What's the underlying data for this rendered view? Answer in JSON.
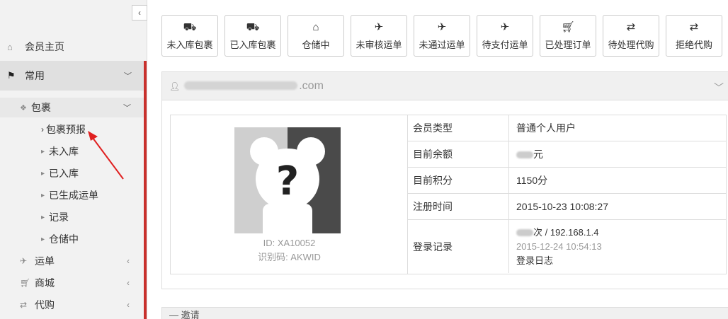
{
  "sidebar": {
    "collapse_glyph": "‹",
    "home": {
      "label": "会员主页",
      "icon": "home-icon"
    },
    "common": {
      "label": "常用",
      "icon": "flag-icon"
    },
    "package": {
      "label": "包裹",
      "icon": "dropbox-icon"
    },
    "package_sub": [
      "包裹预报",
      "未入库",
      "已入库",
      "已生成运单",
      "记录",
      "仓储中"
    ],
    "main_items": [
      {
        "label": "运单",
        "icon": "plane-icon"
      },
      {
        "label": "商城",
        "icon": "cart-icon"
      },
      {
        "label": "代购",
        "icon": "retweet-icon"
      }
    ]
  },
  "toolbar": [
    {
      "label": "未入库包裹",
      "icon": "truck-icon"
    },
    {
      "label": "已入库包裹",
      "icon": "truck-icon"
    },
    {
      "label": "仓储中",
      "icon": "inbox-icon"
    },
    {
      "label": "未审核运单",
      "icon": "plane-icon"
    },
    {
      "label": "未通过运单",
      "icon": "plane-icon"
    },
    {
      "label": "待支付运单",
      "icon": "plane-icon"
    },
    {
      "label": "已处理订单",
      "icon": "cart-icon"
    },
    {
      "label": "待处理代购",
      "icon": "retweet-icon"
    },
    {
      "label": "拒绝代购",
      "icon": "retweet-icon"
    }
  ],
  "profile": {
    "email_suffix": ".com",
    "id_text": "ID: XA10052",
    "code_text": "识别码: AKWID",
    "fields": [
      {
        "key": "会员类型",
        "value": "普通个人用户"
      },
      {
        "key": "目前余额",
        "value": "元"
      },
      {
        "key": "目前积分",
        "value": "1150分"
      },
      {
        "key": "注册时间",
        "value": "2015-10-23 10:08:27"
      }
    ],
    "login": {
      "key": "登录记录",
      "count_suffix": "次",
      "ip": " / 192.168.1.4",
      "time": "2015-12-24 10:54:13",
      "log_link": "登录日志"
    }
  },
  "second_panel": {
    "label": "邀请"
  },
  "colors": {
    "accent_red": "#c9302c",
    "arrow_red": "#e02020"
  }
}
